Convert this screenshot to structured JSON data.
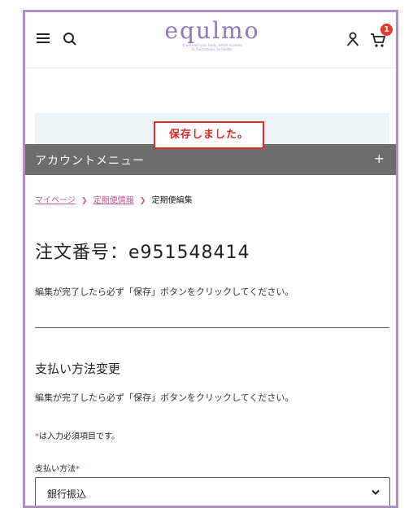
{
  "header": {
    "logo_text": "equlmo",
    "logo_tagline_1": "It will lead your body, which is prone",
    "logo_tagline_2": "to fluctuations, to health.",
    "cart_count": "1",
    "icons": {
      "menu": "hamburger-icon",
      "search": "search-icon",
      "user": "user-icon",
      "cart": "cart-icon"
    }
  },
  "notice": {
    "message": "保存しました。"
  },
  "account_menu": {
    "label": "アカウントメニュー",
    "toggle": "+"
  },
  "breadcrumb": {
    "items": [
      "マイページ",
      "定期便情報",
      "定期便編集"
    ]
  },
  "order": {
    "title": "注文番号：e951548414",
    "instruction": "編集が完了したら必ず「保存」ボタンをクリックしてください。"
  },
  "payment": {
    "section_title": "支払い方法変更",
    "instruction": "編集が完了したら必ず「保存」ボタンをクリックしてください。",
    "required_mark": "*",
    "required_note": "は入力必須項目です。",
    "field_label": "支払い方法",
    "selected_value": "銀行振込"
  },
  "colors": {
    "brand": "#8f77b8",
    "accent_link": "#c15a9b",
    "alert": "#e02c2c",
    "menu_bar": "#6d6d6d",
    "frame_border": "#b48dc6"
  }
}
